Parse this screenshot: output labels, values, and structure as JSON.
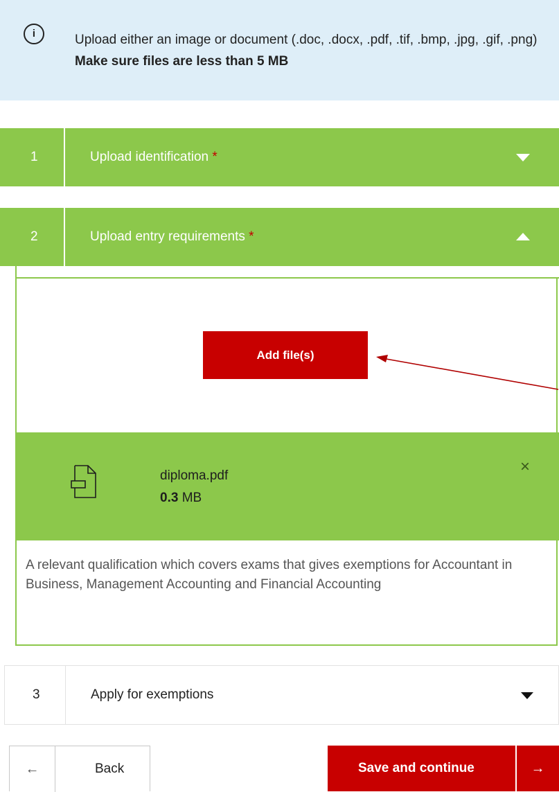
{
  "info": {
    "text_plain": "Upload either an image or document (.doc, .docx, .pdf, .tif, .bmp, .jpg, .gif, .png) ",
    "text_bold": "Make sure files are less than 5 MB",
    "icon": "info-icon"
  },
  "sections": [
    {
      "number": "1",
      "title": "Upload identification",
      "required": "*",
      "state": "collapsed"
    },
    {
      "number": "2",
      "title": "Upload entry requirements",
      "required": "*",
      "state": "expanded"
    },
    {
      "number": "3",
      "title": "Apply for exemptions",
      "state": "collapsed"
    }
  ],
  "upload": {
    "add_button": "Add file(s)",
    "file": {
      "name": "diploma.pdf",
      "size_value": "0.3",
      "size_unit": " MB"
    },
    "description": "A relevant qualification which covers exams that gives exemptions for Accountant in Business, Management Accounting and Financial Accounting"
  },
  "footer": {
    "back_label": "Back",
    "back_arrow": "←",
    "save_label": "Save and continue",
    "save_arrow": "→"
  },
  "colors": {
    "accent_green": "#8cc84b",
    "brand_red": "#c80000",
    "info_bg": "#deeef8"
  }
}
